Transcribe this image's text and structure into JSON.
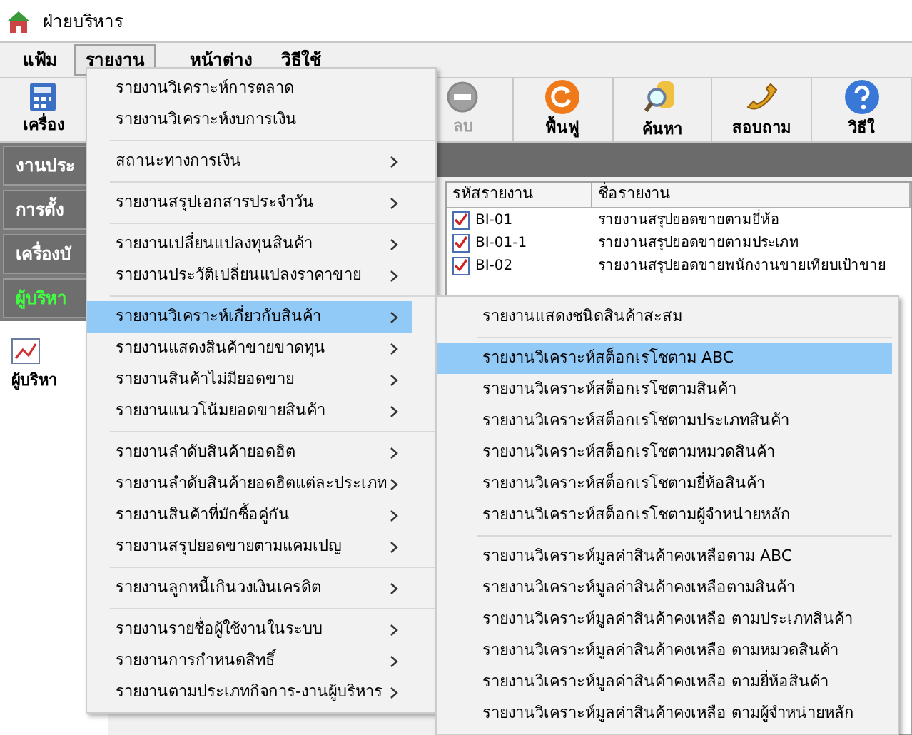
{
  "window": {
    "title": "ฝ่ายบริหาร"
  },
  "menubar": [
    {
      "label": "แฟ้ม",
      "selected": false
    },
    {
      "label": "รายงาน",
      "selected": true
    },
    {
      "label": "หน้าต่าง",
      "selected": false
    },
    {
      "label": "วิธีใช้",
      "selected": false
    }
  ],
  "toolbar": [
    {
      "label": "เครื่อง",
      "kind": "calculator",
      "disabled": false
    },
    {
      "label": "ลบ",
      "kind": "delete",
      "disabled": true
    },
    {
      "label": "ฟื้นฟู",
      "kind": "refresh",
      "disabled": false
    },
    {
      "label": "ค้นหา",
      "kind": "search",
      "disabled": false
    },
    {
      "label": "สอบถาม",
      "kind": "phone",
      "disabled": false
    },
    {
      "label": "วิธีใ",
      "kind": "help",
      "disabled": false
    }
  ],
  "sidebar": {
    "groups": [
      {
        "label": "งานประ",
        "selected": false
      },
      {
        "label": "การตั้ง",
        "selected": false
      },
      {
        "label": "เครื่องบั",
        "selected": false
      },
      {
        "label": "ผู้บริหา",
        "selected": true
      }
    ],
    "items": [
      {
        "label": "ผู้บริหา"
      }
    ]
  },
  "table": {
    "columns": [
      "รหัสรายงาน",
      "ชื่อรายงาน"
    ],
    "rows": [
      [
        "BI-01",
        "รายงานสรุปยอดขายตามยี่ห้อ"
      ],
      [
        "BI-01-1",
        "รายงานสรุปยอดขายตามประเภท"
      ],
      [
        "BI-02",
        "รายงานสรุปยอดขายพนักงานขายเทียบเป้าขาย"
      ]
    ]
  },
  "menu": {
    "groups": [
      [
        {
          "label": "รายงานวิเคราะห์การตลาด",
          "submenu": false,
          "selected": false
        },
        {
          "label": "รายงานวิเคราะห์งบการเงิน",
          "submenu": false,
          "selected": false
        }
      ],
      [
        {
          "label": "สถานะทางการเงิน",
          "submenu": true,
          "selected": false
        }
      ],
      [
        {
          "label": "รายงานสรุปเอกสารประจำวัน",
          "submenu": true,
          "selected": false
        }
      ],
      [
        {
          "label": "รายงานเปลี่ยนแปลงทุนสินค้า",
          "submenu": true,
          "selected": false
        },
        {
          "label": "รายงานประวัติเปลี่ยนแปลงราคาขาย",
          "submenu": true,
          "selected": false
        }
      ],
      [
        {
          "label": "รายงานวิเคราะห์เกี่ยวกับสินค้า",
          "submenu": true,
          "selected": true
        },
        {
          "label": "รายงานแสดงสินค้าขายขาดทุน",
          "submenu": true,
          "selected": false
        },
        {
          "label": "รายงานสินค้าไม่มียอดขาย",
          "submenu": true,
          "selected": false
        },
        {
          "label": "รายงานแนวโน้มยอดขายสินค้า",
          "submenu": true,
          "selected": false
        }
      ],
      [
        {
          "label": "รายงานลำดับสินค้ายอดฮิต",
          "submenu": true,
          "selected": false
        },
        {
          "label": "รายงานลำดับสินค้ายอดฮิตแต่ละประเภท",
          "submenu": true,
          "selected": false
        },
        {
          "label": "รายงานสินค้าที่มักซื้อคู่กัน",
          "submenu": true,
          "selected": false
        },
        {
          "label": "รายงานสรุปยอดขายตามแคมเปญ",
          "submenu": true,
          "selected": false
        }
      ],
      [
        {
          "label": "รายงานลูกหนี้เกินวงเงินเครดิต",
          "submenu": true,
          "selected": false
        }
      ],
      [
        {
          "label": "รายงานรายชื่อผู้ใช้งานในระบบ",
          "submenu": true,
          "selected": false
        },
        {
          "label": "รายงานการกำหนดสิทธิ์",
          "submenu": true,
          "selected": false
        },
        {
          "label": "รายงานตามประเภทกิจการ-งานผู้บริหาร",
          "submenu": true,
          "selected": false
        }
      ]
    ]
  },
  "submenu": {
    "groups": [
      [
        {
          "label": "รายงานแสดงชนิดสินค้าสะสม",
          "selected": false
        }
      ],
      [
        {
          "label": "รายงานวิเคราะห์สต็อกเรโชตาม ABC",
          "selected": true
        },
        {
          "label": "รายงานวิเคราะห์สต็อกเรโชตามสินค้า",
          "selected": false
        },
        {
          "label": "รายงานวิเคราะห์สต็อกเรโชตามประเภทสินค้า",
          "selected": false
        },
        {
          "label": "รายงานวิเคราะห์สต็อกเรโชตามหมวดสินค้า",
          "selected": false
        },
        {
          "label": "รายงานวิเคราะห์สต็อกเรโชตามยี่ห้อสินค้า",
          "selected": false
        },
        {
          "label": "รายงานวิเคราะห์สต็อกเรโชตามผู้จำหน่ายหลัก",
          "selected": false
        }
      ],
      [
        {
          "label": "รายงานวิเคราะห์มูลค่าสินค้าคงเหลือตาม ABC",
          "selected": false
        },
        {
          "label": "รายงานวิเคราะห์มูลค่าสินค้าคงเหลือตามสินค้า",
          "selected": false
        },
        {
          "label": "รายงานวิเคราะห์มูลค่าสินค้าคงเหลือ ตามประเภทสินค้า",
          "selected": false
        },
        {
          "label": "รายงานวิเคราะห์มูลค่าสินค้าคงเหลือ ตามหมวดสินค้า",
          "selected": false
        },
        {
          "label": "รายงานวิเคราะห์มูลค่าสินค้าคงเหลือ ตามยี่ห้อสินค้า",
          "selected": false
        },
        {
          "label": "รายงานวิเคราะห์มูลค่าสินค้าคงเหลือ ตามผู้จำหน่ายหลัก",
          "selected": false
        }
      ]
    ]
  }
}
